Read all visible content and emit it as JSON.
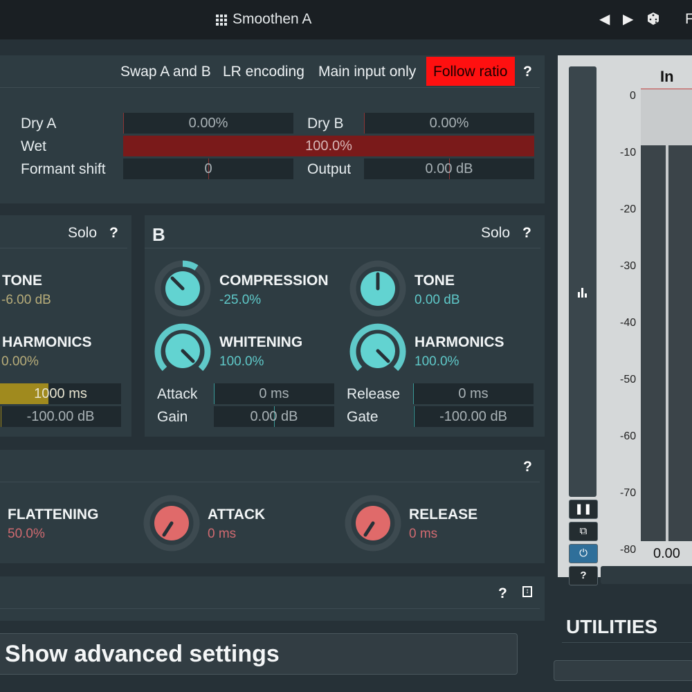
{
  "header": {
    "preset_name": "Smoothen A",
    "right_cut_text": "F"
  },
  "icons": {
    "grid": "grid-icon",
    "prev": "triangle-left-icon",
    "next": "triangle-right-icon",
    "random": "dice-icon"
  },
  "mix": {
    "buttons": [
      "Swap A and B",
      "LR encoding",
      "Main input only",
      "Follow ratio"
    ],
    "follow_ratio_active": true,
    "help": "?",
    "dry_a_label": "Dry A",
    "dry_a_value": "0.00%",
    "dry_b_label": "Dry B",
    "dry_b_value": "0.00%",
    "wet_label": "Wet",
    "wet_value": "100.0%",
    "wet_fraction": 1.0,
    "formant_label": "Formant shift",
    "formant_value": "0",
    "output_label": "Output",
    "output_value": "0.00 dB"
  },
  "section_a": {
    "solo": "Solo",
    "help": "?",
    "tone_title": "TONE",
    "tone_value": "-6.00 dB",
    "harmonics_title": "HARMONICS",
    "harmonics_value": "0.00%",
    "field1_value": "1000 ms",
    "field1_fill": 0.4,
    "field2_value": "-100.00 dB"
  },
  "section_b": {
    "title": "B",
    "solo": "Solo",
    "help": "?",
    "compression_title": "COMPRESSION",
    "compression_value": "-25.0%",
    "tone_title": "TONE",
    "tone_value": "0.00 dB",
    "whitening_title": "WHITENING",
    "whitening_value": "100.0%",
    "harmonics_title": "HARMONICS",
    "harmonics_value": "100.0%",
    "attack_label": "Attack",
    "attack_value": "0 ms",
    "release_label": "Release",
    "release_value": "0 ms",
    "gain_label": "Gain",
    "gain_value": "0.00 dB",
    "gate_label": "Gate",
    "gate_value": "-100.00 dB"
  },
  "flattening": {
    "help": "?",
    "flattening_title": "FLATTENING",
    "flattening_value": "50.0%",
    "attack_title": "ATTACK",
    "attack_value": "0 ms",
    "release_title": "RELEASE",
    "release_value": "0 ms"
  },
  "bottom_bar": {
    "help": "?"
  },
  "advanced_button": "Show advanced settings",
  "meter": {
    "title": "In",
    "scale": [
      "0",
      "-10",
      "-20",
      "-30",
      "-40",
      "-50",
      "-60",
      "-70",
      "-80"
    ],
    "readout": "0.00",
    "level_db": -10
  },
  "utilities": "UTILITIES",
  "colors": {
    "accent_teal": "#5fc9c9",
    "active_red": "#ff1010",
    "wet_bar": "#7a1a1a",
    "knob_red": "#e06a6a"
  }
}
